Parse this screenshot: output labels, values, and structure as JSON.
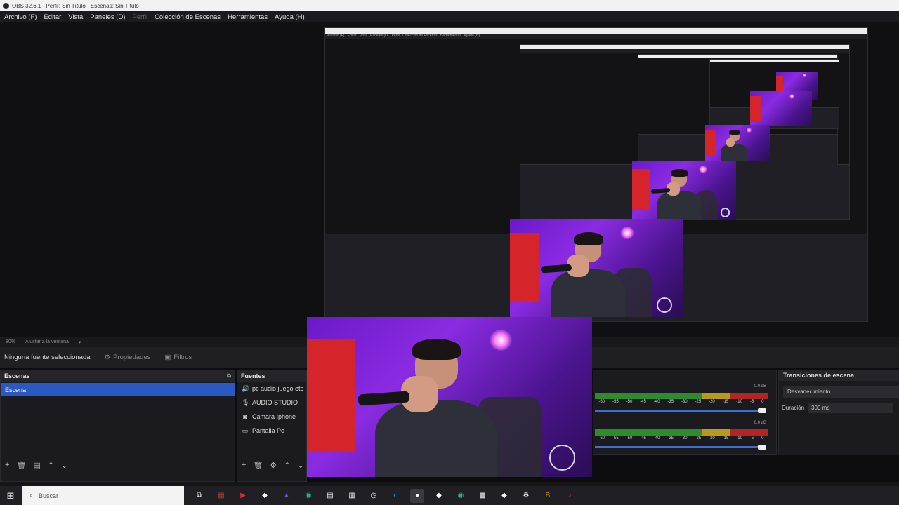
{
  "window": {
    "title": "OBS 32.6.1 - Perfil: Sin Título - Escenas: Sin Título"
  },
  "menu": {
    "items": [
      {
        "label": "Archivo (F)",
        "enabled": true
      },
      {
        "label": "Editar",
        "enabled": true
      },
      {
        "label": "Vista",
        "enabled": true
      },
      {
        "label": "Paneles (D)",
        "enabled": true
      },
      {
        "label": "Perfil",
        "enabled": false
      },
      {
        "label": "Colección de Escenas",
        "enabled": true
      },
      {
        "label": "Herramientas",
        "enabled": true
      },
      {
        "label": "Ayuda (H)",
        "enabled": true
      }
    ]
  },
  "zoom_bar": {
    "zoom": "80%",
    "fit": "Ajustar a la ventana"
  },
  "properties_bar": {
    "no_source": "Ninguna fuente seleccionada",
    "properties_label": "Propiedades",
    "filters_label": "Filtros"
  },
  "scenes": {
    "title": "Escenas",
    "items": [
      "Escena"
    ]
  },
  "sources": {
    "title": "Fuentes",
    "items": [
      {
        "label": "pc audio juego etc",
        "icon": "speaker-icon"
      },
      {
        "label": "AUDIO STUDIO",
        "icon": "microphone-icon"
      },
      {
        "label": "Camara Iphone",
        "icon": "camera-icon"
      },
      {
        "label": "Pantalla Pc",
        "icon": "monitor-icon"
      }
    ]
  },
  "mixer": {
    "tracks": [
      {
        "db": "0.0 dB",
        "ticks": [
          "-60",
          "-55",
          "-50",
          "-45",
          "-40",
          "-35",
          "-30",
          "-25",
          "-20",
          "-15",
          "-10",
          "-5",
          "0"
        ]
      },
      {
        "db": "0.0 dB",
        "ticks": [
          "-60",
          "-55",
          "-50",
          "-45",
          "-40",
          "-35",
          "-30",
          "-25",
          "-20",
          "-15",
          "-10",
          "-5",
          "0"
        ]
      }
    ]
  },
  "transitions": {
    "title": "Transiciones de escena",
    "selected": "Desvanecimiento",
    "duration_label": "Duración",
    "duration_value": "300 ms"
  },
  "taskbar": {
    "search_placeholder": "Buscar",
    "apps": [
      "task-view-icon",
      "film-app-icon",
      "youtube-icon",
      "app-icon",
      "proton-icon",
      "chrome-icon",
      "notepad-icon",
      "files-icon",
      "clock-app-icon",
      "edge-icon",
      "obs-icon",
      "app-icon",
      "chrome-icon",
      "calendar-icon",
      "app-icon",
      "steam-icon",
      "brave-icon",
      "tiktok-icon"
    ]
  },
  "colors": {
    "accent": "#2b59c3",
    "panel": "#1b1b1f",
    "meter_green": "#2e8b2e",
    "meter_yellow": "#b59a1e",
    "meter_red": "#b32424"
  }
}
